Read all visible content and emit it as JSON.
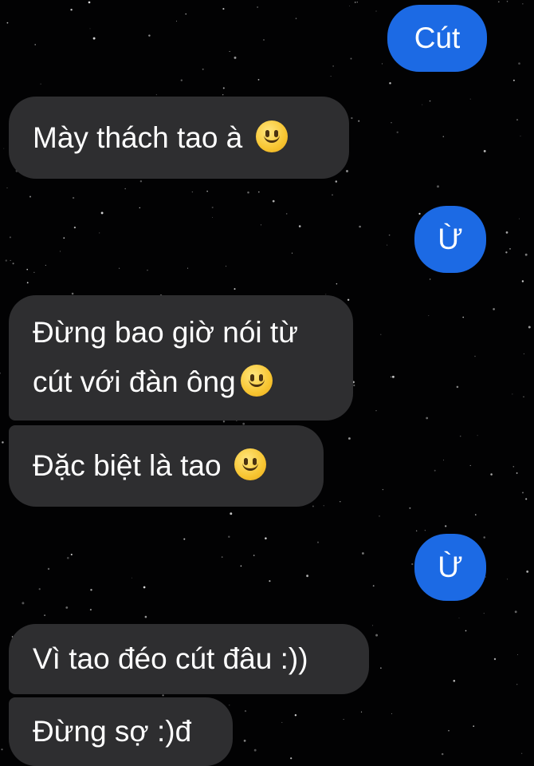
{
  "messages": [
    {
      "side": "out",
      "text": "Cút"
    },
    {
      "side": "in",
      "text": "Mày thách tao à",
      "emoji": "slight-smile-emoji"
    },
    {
      "side": "out",
      "text": "Ừ"
    },
    {
      "side": "in",
      "line1": "Đừng bao giờ nói từ",
      "line2": "cút với đàn ông",
      "emoji": "slight-smile-emoji"
    },
    {
      "side": "in",
      "text": "Đặc biệt là tao",
      "emoji": "slight-smile-emoji"
    },
    {
      "side": "out",
      "text": "Ừ"
    },
    {
      "side": "in",
      "text": "Vì tao đéo cút đâu :))"
    },
    {
      "side": "in",
      "text": "Đừng sợ :)đ"
    }
  ],
  "colors": {
    "background": "#020203",
    "incoming_bubble": "#2e2e30",
    "outgoing_bubble": "#1c6ae4",
    "text": "#ffffff"
  }
}
